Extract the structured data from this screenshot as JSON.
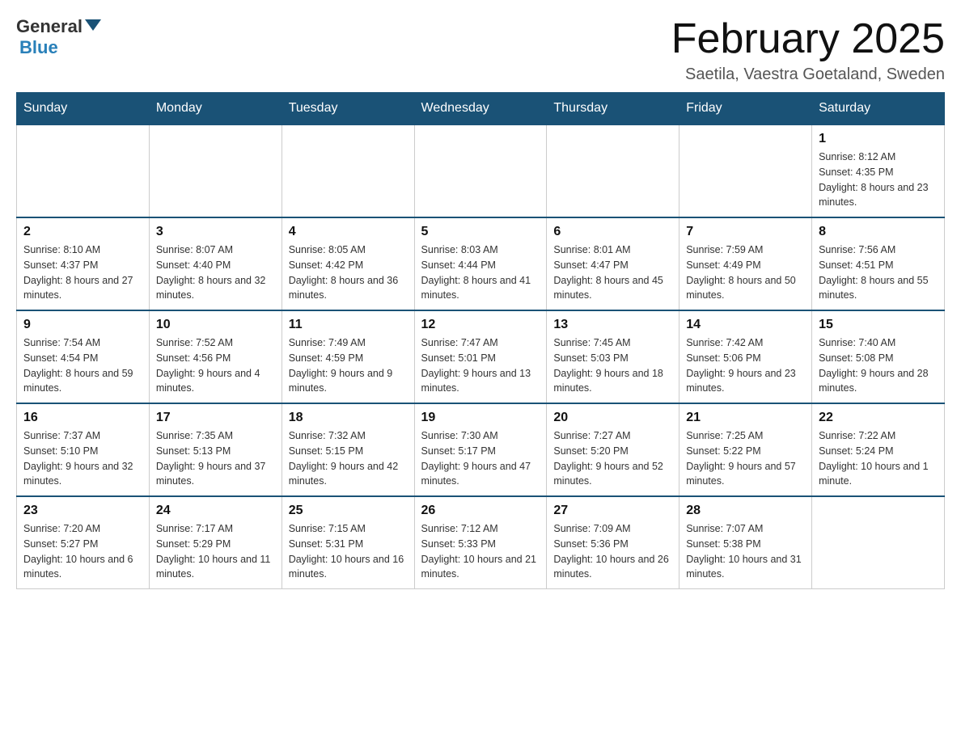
{
  "header": {
    "logo_general": "General",
    "logo_blue": "Blue",
    "title": "February 2025",
    "location": "Saetila, Vaestra Goetaland, Sweden"
  },
  "weekdays": [
    "Sunday",
    "Monday",
    "Tuesday",
    "Wednesday",
    "Thursday",
    "Friday",
    "Saturday"
  ],
  "weeks": [
    [
      {
        "day": "",
        "info": ""
      },
      {
        "day": "",
        "info": ""
      },
      {
        "day": "",
        "info": ""
      },
      {
        "day": "",
        "info": ""
      },
      {
        "day": "",
        "info": ""
      },
      {
        "day": "",
        "info": ""
      },
      {
        "day": "1",
        "info": "Sunrise: 8:12 AM\nSunset: 4:35 PM\nDaylight: 8 hours and 23 minutes."
      }
    ],
    [
      {
        "day": "2",
        "info": "Sunrise: 8:10 AM\nSunset: 4:37 PM\nDaylight: 8 hours and 27 minutes."
      },
      {
        "day": "3",
        "info": "Sunrise: 8:07 AM\nSunset: 4:40 PM\nDaylight: 8 hours and 32 minutes."
      },
      {
        "day": "4",
        "info": "Sunrise: 8:05 AM\nSunset: 4:42 PM\nDaylight: 8 hours and 36 minutes."
      },
      {
        "day": "5",
        "info": "Sunrise: 8:03 AM\nSunset: 4:44 PM\nDaylight: 8 hours and 41 minutes."
      },
      {
        "day": "6",
        "info": "Sunrise: 8:01 AM\nSunset: 4:47 PM\nDaylight: 8 hours and 45 minutes."
      },
      {
        "day": "7",
        "info": "Sunrise: 7:59 AM\nSunset: 4:49 PM\nDaylight: 8 hours and 50 minutes."
      },
      {
        "day": "8",
        "info": "Sunrise: 7:56 AM\nSunset: 4:51 PM\nDaylight: 8 hours and 55 minutes."
      }
    ],
    [
      {
        "day": "9",
        "info": "Sunrise: 7:54 AM\nSunset: 4:54 PM\nDaylight: 8 hours and 59 minutes."
      },
      {
        "day": "10",
        "info": "Sunrise: 7:52 AM\nSunset: 4:56 PM\nDaylight: 9 hours and 4 minutes."
      },
      {
        "day": "11",
        "info": "Sunrise: 7:49 AM\nSunset: 4:59 PM\nDaylight: 9 hours and 9 minutes."
      },
      {
        "day": "12",
        "info": "Sunrise: 7:47 AM\nSunset: 5:01 PM\nDaylight: 9 hours and 13 minutes."
      },
      {
        "day": "13",
        "info": "Sunrise: 7:45 AM\nSunset: 5:03 PM\nDaylight: 9 hours and 18 minutes."
      },
      {
        "day": "14",
        "info": "Sunrise: 7:42 AM\nSunset: 5:06 PM\nDaylight: 9 hours and 23 minutes."
      },
      {
        "day": "15",
        "info": "Sunrise: 7:40 AM\nSunset: 5:08 PM\nDaylight: 9 hours and 28 minutes."
      }
    ],
    [
      {
        "day": "16",
        "info": "Sunrise: 7:37 AM\nSunset: 5:10 PM\nDaylight: 9 hours and 32 minutes."
      },
      {
        "day": "17",
        "info": "Sunrise: 7:35 AM\nSunset: 5:13 PM\nDaylight: 9 hours and 37 minutes."
      },
      {
        "day": "18",
        "info": "Sunrise: 7:32 AM\nSunset: 5:15 PM\nDaylight: 9 hours and 42 minutes."
      },
      {
        "day": "19",
        "info": "Sunrise: 7:30 AM\nSunset: 5:17 PM\nDaylight: 9 hours and 47 minutes."
      },
      {
        "day": "20",
        "info": "Sunrise: 7:27 AM\nSunset: 5:20 PM\nDaylight: 9 hours and 52 minutes."
      },
      {
        "day": "21",
        "info": "Sunrise: 7:25 AM\nSunset: 5:22 PM\nDaylight: 9 hours and 57 minutes."
      },
      {
        "day": "22",
        "info": "Sunrise: 7:22 AM\nSunset: 5:24 PM\nDaylight: 10 hours and 1 minute."
      }
    ],
    [
      {
        "day": "23",
        "info": "Sunrise: 7:20 AM\nSunset: 5:27 PM\nDaylight: 10 hours and 6 minutes."
      },
      {
        "day": "24",
        "info": "Sunrise: 7:17 AM\nSunset: 5:29 PM\nDaylight: 10 hours and 11 minutes."
      },
      {
        "day": "25",
        "info": "Sunrise: 7:15 AM\nSunset: 5:31 PM\nDaylight: 10 hours and 16 minutes."
      },
      {
        "day": "26",
        "info": "Sunrise: 7:12 AM\nSunset: 5:33 PM\nDaylight: 10 hours and 21 minutes."
      },
      {
        "day": "27",
        "info": "Sunrise: 7:09 AM\nSunset: 5:36 PM\nDaylight: 10 hours and 26 minutes."
      },
      {
        "day": "28",
        "info": "Sunrise: 7:07 AM\nSunset: 5:38 PM\nDaylight: 10 hours and 31 minutes."
      },
      {
        "day": "",
        "info": ""
      }
    ]
  ]
}
